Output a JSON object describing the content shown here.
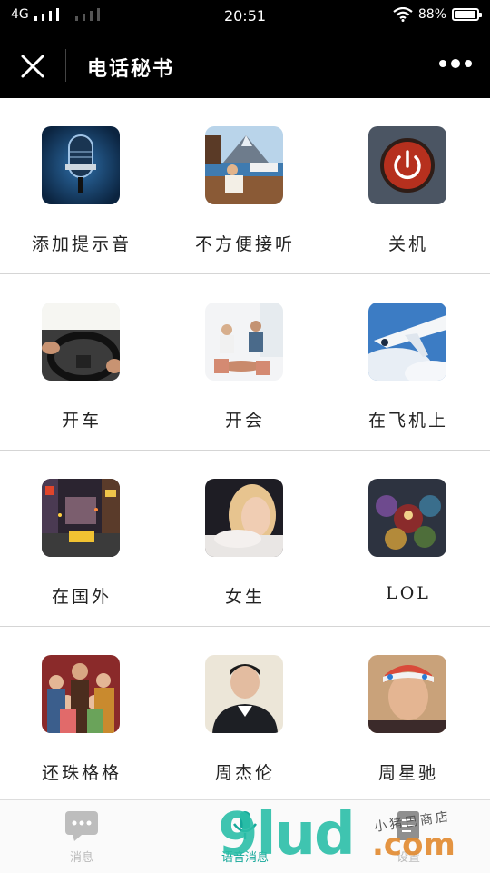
{
  "status": {
    "network": "4G",
    "time": "20:51",
    "battery": "88%",
    "battery_level": 0.88
  },
  "nav": {
    "title": "电话秘书"
  },
  "grid": {
    "items": [
      {
        "label": "添加提示音",
        "icon": "microphone-icon"
      },
      {
        "label": "不方便接听",
        "icon": "lake-photo-icon"
      },
      {
        "label": "关机",
        "icon": "power-icon"
      },
      {
        "label": "开车",
        "icon": "steering-wheel-photo-icon"
      },
      {
        "label": "开会",
        "icon": "meeting-photo-icon"
      },
      {
        "label": "在飞机上",
        "icon": "airplane-photo-icon"
      },
      {
        "label": "在国外",
        "icon": "city-street-photo-icon"
      },
      {
        "label": "女生",
        "icon": "girl-photo-icon"
      },
      {
        "label": "LOL",
        "icon": "game-art-photo-icon"
      },
      {
        "label": "还珠格格",
        "icon": "drama-cast-photo-icon"
      },
      {
        "label": "周杰伦",
        "icon": "singer-photo-icon"
      },
      {
        "label": "周星驰",
        "icon": "actor-photo-icon"
      }
    ]
  },
  "tabs": [
    {
      "label": "消息",
      "icon": "chat-bubble-icon"
    },
    {
      "label": "语音消息",
      "icon": "voice-icon"
    },
    {
      "label": "设置",
      "icon": "document-icon"
    }
  ],
  "watermark": {
    "main": "9lud",
    "domain": ".com",
    "shop": "小猪巴商店"
  },
  "colors": {
    "bar_bg": "#000000",
    "accent": "#16a89a",
    "divider": "#d5d5d5"
  }
}
